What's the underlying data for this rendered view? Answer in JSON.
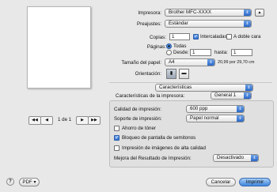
{
  "printer": {
    "label": "Impresora:",
    "value": "Brother  MFC-XXXX"
  },
  "presets": {
    "label": "Preajustes:",
    "value": "Estándar"
  },
  "copies": {
    "label": "Copias:",
    "value": "1",
    "collated_label": "Intercaladas",
    "duplex_label": "A doble cara"
  },
  "pages": {
    "label": "Páginas:",
    "all_label": "Todas",
    "from_label": "Desde:",
    "from_value": "1",
    "to_label": "hasta:",
    "to_value": "1"
  },
  "paper_size": {
    "label": "Tamaño del papel:",
    "value": "A4",
    "dimensions": "20,99 por 29,70 cm"
  },
  "orientation": {
    "label": "Orientación:"
  },
  "section": {
    "value": "Características"
  },
  "printer_features": {
    "label": "Características de la impresora:",
    "value": "General 1"
  },
  "quality": {
    "label": "Calidad de impresión:",
    "value": "600 ppp"
  },
  "media": {
    "label": "Soporte de impresión:",
    "value": "Papel normal"
  },
  "toner_save": {
    "label": "Ahorro de tóner",
    "checked": false
  },
  "halftone_lock": {
    "label": "Bloqueo de pantalla de semitonos",
    "checked": true
  },
  "hq_image": {
    "label": "Impresión de imágenes de alta calidad",
    "checked": false
  },
  "improve": {
    "label": "Mejora del Resultado de Impresión:",
    "value": "Desactivado"
  },
  "pager": {
    "text": "1 de 1",
    "first": "◀◀",
    "prev": "◀",
    "next": "▶",
    "last": "▶▶"
  },
  "footer": {
    "help": "?",
    "pdf": "PDF ▾",
    "cancel": "Cancelar",
    "print": "Imprimir"
  },
  "glyphs": {
    "popup_arrow": "⇕",
    "check": "✓",
    "portrait": "▮",
    "landscape": "▬",
    "up": "▲"
  }
}
